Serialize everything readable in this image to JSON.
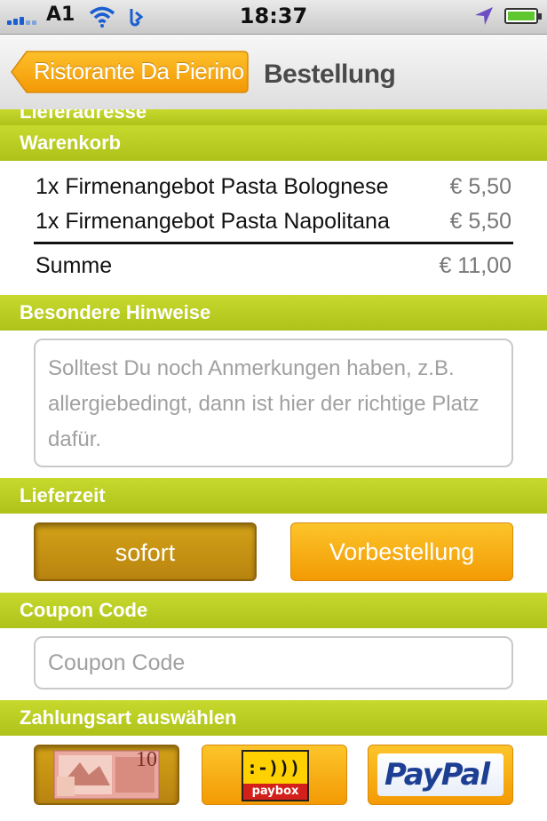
{
  "status_bar": {
    "carrier": "A1",
    "time": "18:37"
  },
  "nav": {
    "back_label": "Ristorante Da Pierino",
    "title": "Bestellung"
  },
  "sections": {
    "delivery_address": "Lieferadresse",
    "cart": "Warenkorb",
    "notes": "Besondere Hinweise",
    "delivery_time": "Lieferzeit",
    "coupon": "Coupon Code",
    "payment": "Zahlungsart auswählen"
  },
  "cart": {
    "items": [
      {
        "label": "1x Firmenangebot Pasta Bolognese",
        "price": "€ 5,50"
      },
      {
        "label": "1x Firmenangebot Pasta Napolitana",
        "price": "€ 5,50"
      }
    ],
    "sum_label": "Summe",
    "sum_value": "€ 11,00"
  },
  "notes": {
    "placeholder": "Solltest Du noch Anmerkungen haben, z.B. allergiebedingt, dann ist hier der richtige Platz dafür."
  },
  "delivery_time": {
    "option_now": "sofort",
    "option_preorder": "Vorbestellung",
    "selected": "sofort"
  },
  "coupon": {
    "placeholder": "Coupon Code"
  },
  "payment": {
    "cash_note": "10",
    "paybox_label": "paybox",
    "paypal_label": "PayPal"
  },
  "colors": {
    "section": "#b5c91f",
    "orange": "#f7a30c",
    "selected": "#c18d12"
  }
}
